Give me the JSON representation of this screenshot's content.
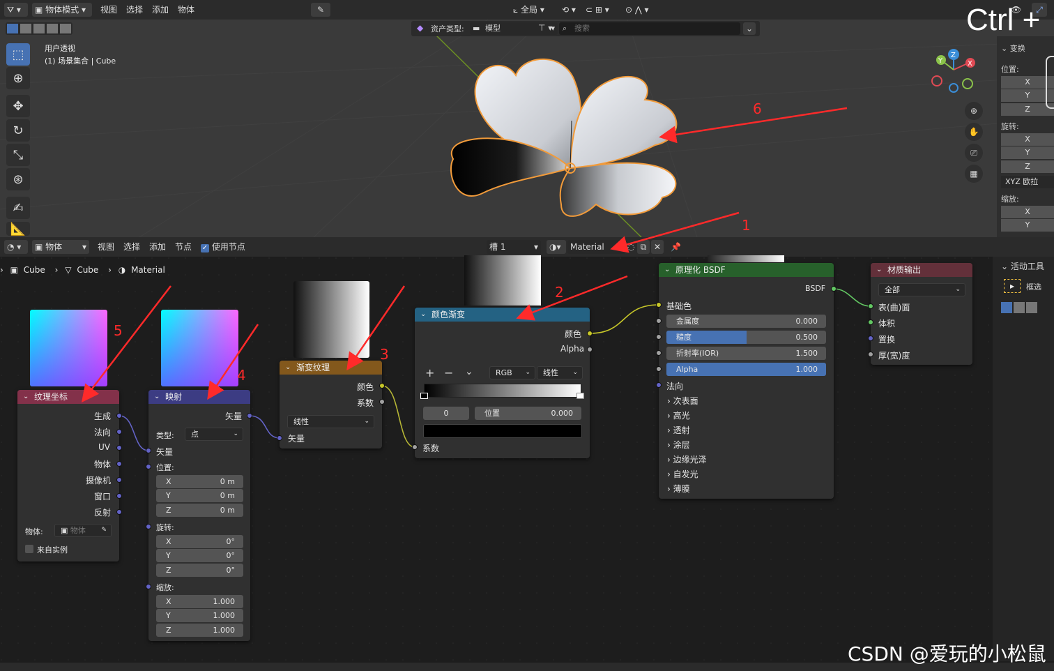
{
  "viewport": {
    "header": {
      "mode": "物体模式",
      "menu": [
        "视图",
        "选择",
        "添加",
        "物体"
      ],
      "transform_orientation": "全局",
      "asset_type_label": "资产类型:",
      "asset_type_value": "模型",
      "search_placeholder": "搜索"
    },
    "overlay": {
      "view_name": "用户透视",
      "collection": "(1) 场景集合 | Cube",
      "ctrl_hint": "Ctrl +"
    },
    "npanel": {
      "section": "变换",
      "location_label": "位置:",
      "rotation_label": "旋转:",
      "scale_label": "缩放:",
      "axes": [
        "X",
        "Y",
        "Z"
      ],
      "rotation_mode": "XYZ 欧拉"
    },
    "gizmo": {
      "x": "X",
      "y": "Y",
      "z": "Z"
    }
  },
  "node_editor": {
    "header": {
      "object_mode": "物体",
      "menu": [
        "视图",
        "选择",
        "添加",
        "节点"
      ],
      "use_nodes": "使用节点",
      "slot": "槽 1",
      "material": "Material"
    },
    "breadcrumb": [
      "Cube",
      "Cube",
      "Material"
    ],
    "right_panel": {
      "section": "活动工具",
      "tool": "框选"
    }
  },
  "nodes": {
    "texcoord": {
      "title": "纹理坐标",
      "outputs": [
        "生成",
        "法向",
        "UV",
        "物体",
        "摄像机",
        "窗口",
        "反射"
      ],
      "object_label": "物体:",
      "object_placeholder": "物体",
      "from_instancer": "来自实例"
    },
    "mapping": {
      "title": "映射",
      "output": "矢量",
      "type_label": "类型:",
      "type_value": "点",
      "input_vector": "矢量",
      "location_label": "位置:",
      "location": [
        [
          "X",
          "0 m"
        ],
        [
          "Y",
          "0 m"
        ],
        [
          "Z",
          "0 m"
        ]
      ],
      "rotation_label": "旋转:",
      "rotation": [
        [
          "X",
          "0°"
        ],
        [
          "Y",
          "0°"
        ],
        [
          "Z",
          "0°"
        ]
      ],
      "scale_label": "缩放:",
      "scale": [
        [
          "X",
          "1.000"
        ],
        [
          "Y",
          "1.000"
        ],
        [
          "Z",
          "1.000"
        ]
      ]
    },
    "gradient": {
      "title": "渐变纹理",
      "outputs": [
        "颜色",
        "系数"
      ],
      "type_value": "线性",
      "input_vector": "矢量"
    },
    "colorramp": {
      "title": "颜色渐变",
      "outputs": [
        "颜色",
        "Alpha"
      ],
      "color_mode": "RGB",
      "interpolation": "线性",
      "stop_index": "0",
      "pos_label": "位置",
      "pos_value": "0.000",
      "input_fac": "系数"
    },
    "bsdf": {
      "title": "原理化 BSDF",
      "output": "BSDF",
      "base_color": "基础色",
      "fields": [
        {
          "label": "金属度",
          "value": "0.000",
          "fill": 0.0
        },
        {
          "label": "糙度",
          "value": "0.500",
          "fill": 0.5
        },
        {
          "label": "折射率(IOR)",
          "value": "1.500",
          "fill": 0.0
        },
        {
          "label": "Alpha",
          "value": "1.000",
          "fill": 1.0
        }
      ],
      "normal": "法向",
      "panels": [
        "次表面",
        "高光",
        "透射",
        "涂层",
        "边缘光泽",
        "自发光",
        "薄膜"
      ]
    },
    "output": {
      "title": "材质输出",
      "target": "全部",
      "inputs": [
        "表(曲)面",
        "体积",
        "置换",
        "厚(宽)度"
      ]
    }
  },
  "annotations": [
    "1",
    "2",
    "3",
    "4",
    "5",
    "6"
  ],
  "watermark": "CSDN @爱玩的小松鼠",
  "colors": {
    "accent_blue": "#4772b3",
    "texcoord_header": "#83314a",
    "mapping_header": "#3c3c83",
    "gradient_header": "#83581c",
    "colorramp_header": "#246283",
    "bsdf_header": "#27602b",
    "output_header": "#63303a",
    "annotation_red": "#ff2a2a",
    "selection_orange": "#f29b3a"
  }
}
